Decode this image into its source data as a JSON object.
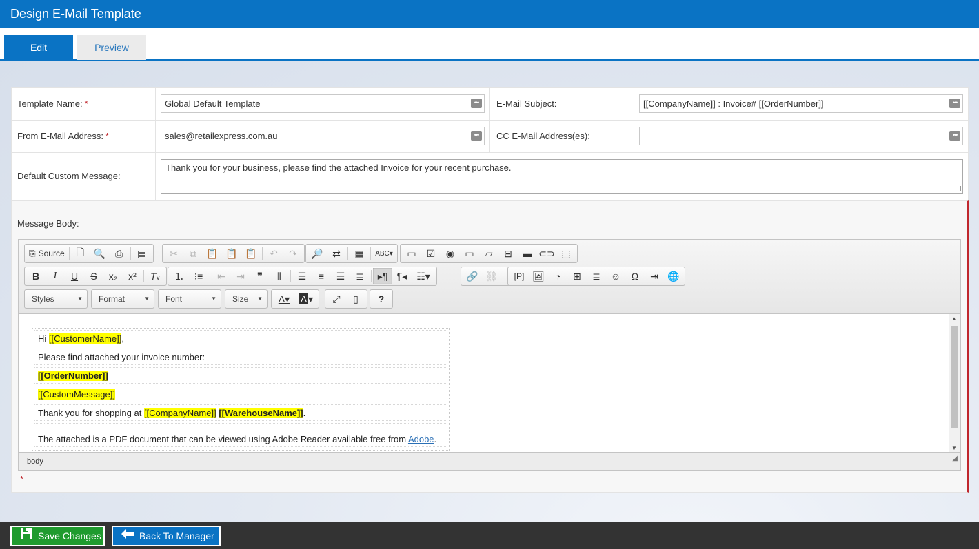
{
  "app": {
    "title": "Design E-Mail Template"
  },
  "tabs": [
    {
      "label": "Edit",
      "active": true
    },
    {
      "label": "Preview",
      "active": false
    }
  ],
  "form": {
    "template_name_label": "Template Name:",
    "template_name_value": "Global Default Template",
    "email_subject_label": "E-Mail Subject:",
    "email_subject_value": "[[CompanyName]] : Invoice# [[OrderNumber]]",
    "from_email_label": "From E-Mail Address:",
    "from_email_value": "sales@retailexpress.com.au",
    "cc_email_label": "CC E-Mail Address(es):",
    "cc_email_value": "",
    "custom_message_label": "Default Custom Message:",
    "custom_message_value": "Thank you for your business, please find the attached Invoice for your recent purchase.",
    "required_marker": "*"
  },
  "editor": {
    "label": "Message Body:",
    "source_label": "Source",
    "styles_label": "Styles",
    "format_label": "Format",
    "font_label": "Font",
    "size_label": "Size",
    "path_label": "body",
    "lines": {
      "hi": "Hi ",
      "customer_name": "[[CustomerName]]",
      "comma": ",",
      "please_find": "Please find attached your invoice number:",
      "order_number": "[[OrderNumber]]",
      "custom_message": "[[CustomMessage]]",
      "thank_you": "Thank you for shopping at ",
      "company_name": "[[CompanyName]]",
      "space": " ",
      "warehouse_name": "[[WarehouseName]]",
      "period": ".",
      "attached": "The attached is a PDF document that can be viewed using Adobe Reader available free from ",
      "adobe_link": "Adobe",
      "period2": "."
    },
    "highlight_color": "#ffff00"
  },
  "footer": {
    "save_label": "Save Changes",
    "back_label": "Back To Manager"
  },
  "colors": {
    "brand": "#0a73c4",
    "save": "#1f9b2e",
    "required": "#c0272d",
    "footer_bg": "#333333"
  }
}
